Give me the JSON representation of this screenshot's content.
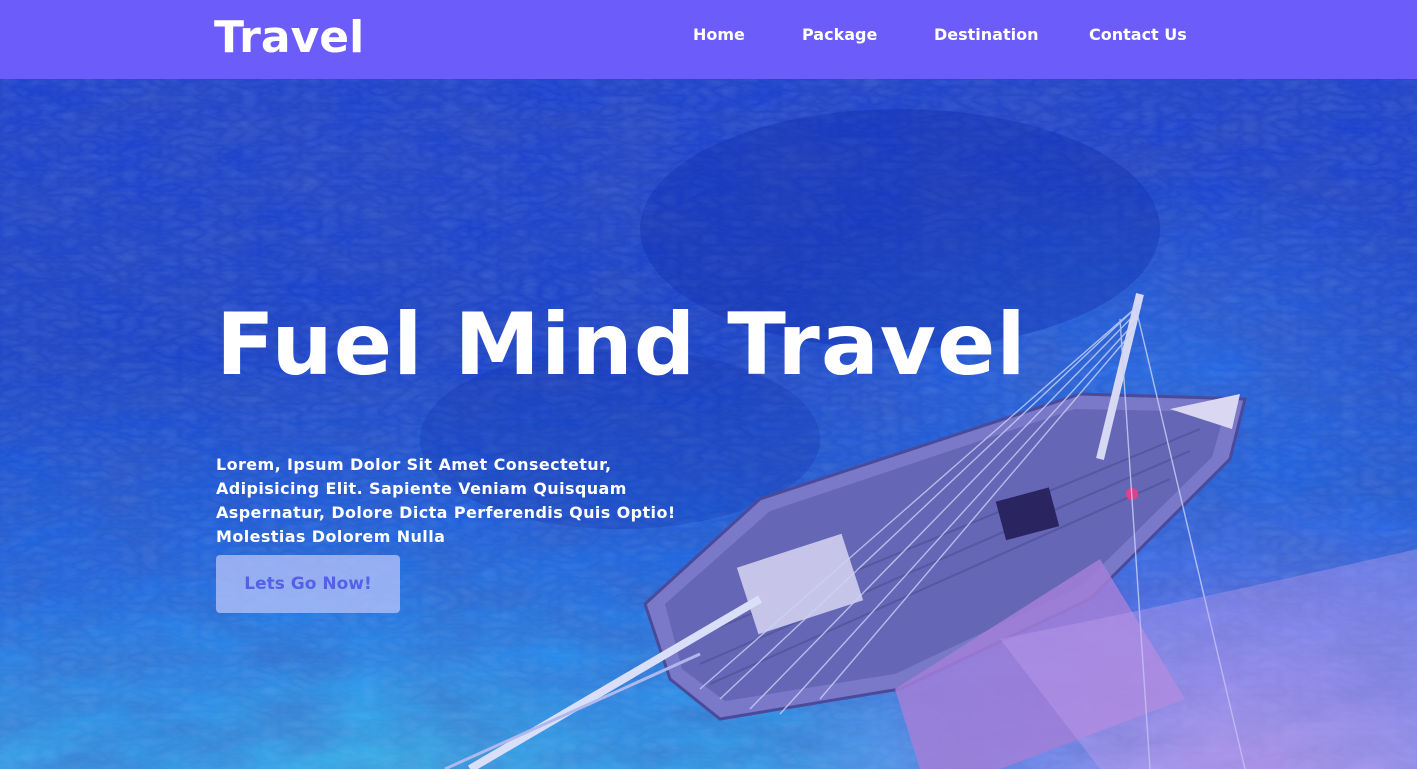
{
  "header": {
    "logo": "Travel",
    "nav": [
      {
        "label": "Home"
      },
      {
        "label": "Package"
      },
      {
        "label": "Destination"
      },
      {
        "label": "Contact Us"
      }
    ]
  },
  "hero": {
    "title": "Fuel Mind Travel",
    "text": "Lorem, Ipsum Dolor Sit Amet Consectetur, Adipisicing Elit. Sapiente Veniam Quisquam Aspernatur, Dolore Dicta Perferendis Quis Optio! Molestias Dolorem Nulla",
    "button_label": "Lets Go Now!",
    "image_icon": "boat-on-beach-aerial-photo"
  },
  "colors": {
    "header_bg": "#6c5cf9",
    "text": "#ffffff",
    "button_text": "#5560e8",
    "ocean_deep": "#1a3fd0",
    "ocean_shallow": "#3ab3ee",
    "sand_tint": "#c496f0"
  }
}
